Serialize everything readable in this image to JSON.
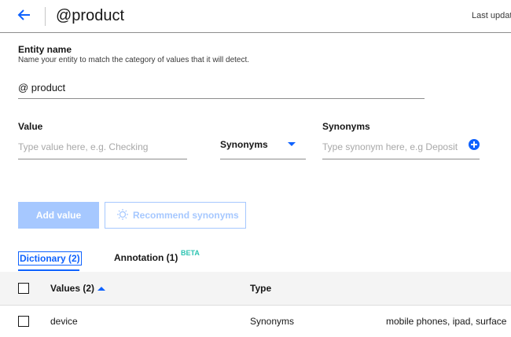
{
  "header": {
    "title": "@product",
    "last_updated": "Last updat"
  },
  "entity": {
    "label": "Entity name",
    "helper": "Name your entity to match the category of values that it will detect.",
    "value": "@ product"
  },
  "value_form": {
    "value_label": "Value",
    "value_placeholder": "Type value here, e.g. Checking",
    "type_selected": "Synonyms",
    "synonyms_label": "Synonyms",
    "synonyms_placeholder": "Type synonym here, e.g Deposit"
  },
  "buttons": {
    "add_value": "Add value",
    "recommend": "Recommend synonyms"
  },
  "tabs": [
    {
      "label": "Dictionary (2)",
      "active": true
    },
    {
      "label": "Annotation (1)",
      "badge": "BETA"
    }
  ],
  "table": {
    "columns": [
      "Values (2)",
      "Type"
    ],
    "rows": [
      {
        "value": "device",
        "type": "Synonyms",
        "synonyms": "mobile phones, ipad, surface"
      }
    ]
  },
  "colors": {
    "accent": "#0f62fe",
    "disabled_button": "#a6c8ff",
    "beta": "#2dc4b2"
  },
  "icons": [
    "arrow-left-icon",
    "chevron-down-icon",
    "add-circle-icon",
    "lightbulb-icon",
    "sort-up-icon",
    "checkbox-icon"
  ]
}
